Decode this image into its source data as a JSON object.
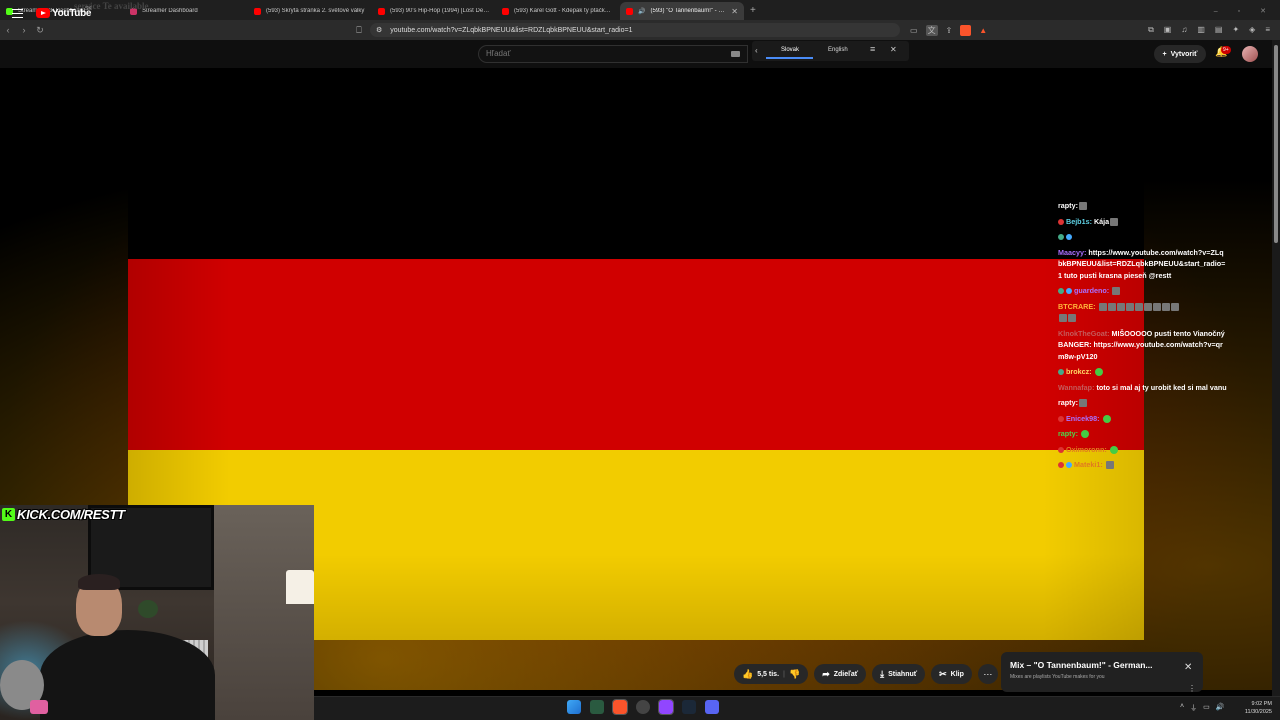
{
  "browser": {
    "tabs": [
      {
        "label": "Stream - Kick Dashboard",
        "color": "#53fc18",
        "active": false
      },
      {
        "label": "Streamer Dashboard",
        "color": "#cc3366",
        "active": false
      },
      {
        "label": "(593) Skrytá stránka 2. světové války",
        "color": "#ff0000",
        "active": false
      },
      {
        "label": "(593) 90's Hip-Hop (1994) [Lost Demos]",
        "color": "#ff0000",
        "active": false
      },
      {
        "label": "(593) Karel Gott - Kdepak ty ptáčku hnízdo máš",
        "color": "#ff0000",
        "active": false
      },
      {
        "label": "(593) \"O Tannenbaum!\" - German Christmas",
        "color": "#ff0000",
        "active": true
      }
    ],
    "bg_overlay_text": "service  Te            available",
    "url": "youtube.com/watch?v=ZLqbkBPNEUU&list=RDZLqbkBPNEUU&start_radio=1"
  },
  "youtube": {
    "logo_text": "YouTube",
    "country_code": "SK",
    "search_placeholder": "Hľadať",
    "create_label": "Vytvoriť",
    "notification_count": "9+"
  },
  "translator": {
    "lang_from": "Slovak",
    "lang_to": "English"
  },
  "video": {
    "flag_colors": [
      "#000000",
      "#d00000",
      "#f2cc00"
    ]
  },
  "chat": [
    {
      "user": "",
      "text": "rapty:",
      "user_color": "#ffffff"
    },
    {
      "user": "Bejb1s:",
      "text": "Kája",
      "user_color": "#5fd3e6"
    },
    {
      "user": "",
      "text": "",
      "user_color": "#ffffff"
    },
    {
      "user": "Maacyy:",
      "text": "https://www.youtube.com/watch?v=ZLqbkBPNEUU&list=RDZLqbkBPNEUU&start_radio=1 tuto pusti krasna pieseň @restt",
      "user_color": "#a970ff"
    },
    {
      "user": "guardeno:",
      "text": "",
      "user_color": "#a970ff"
    },
    {
      "user": "BTCRARE:",
      "text": "",
      "user_color": "#ffb43a"
    },
    {
      "user": "KlnokTheGoat:",
      "text": "MIŠOOOOO pusti tento Vianočný BANGER: https://www.youtube.com/watch?v=qrm8w-pV120",
      "user_color": "#c45a5a"
    },
    {
      "user": "brokcz:",
      "text": "",
      "user_color": "#ffd966"
    },
    {
      "user": "Wannafap:",
      "text": "toto si mal aj ty urobit ked si mal vanu",
      "user_color": "#c45a5a"
    },
    {
      "user": "",
      "text": "rapty:",
      "user_color": "#ffffff"
    },
    {
      "user": "Enicek98:",
      "text": "",
      "user_color": "#a970ff"
    },
    {
      "user": "rapty:",
      "text": "",
      "user_color": "#4bd64b"
    },
    {
      "user": "Oximoronn:",
      "text": "",
      "user_color": "#e07a20"
    },
    {
      "user": "Mateki1:",
      "text": "",
      "user_color": "#e07a20"
    }
  ],
  "webcam": {
    "kick_logo": "K",
    "channel_url": "KICK.COM/RESTT"
  },
  "actions": {
    "like_count": "5,5 tis.",
    "share": "Zdieľať",
    "download": "Stiahnuť",
    "clip": "Klip"
  },
  "mix": {
    "title": "Mix – \"O Tannenbaum!\" - German...",
    "subtitle": "Mixes are playlists YouTube makes for you"
  },
  "taskbar": {
    "time": "9:02 PM",
    "date": "11/30/2025"
  }
}
